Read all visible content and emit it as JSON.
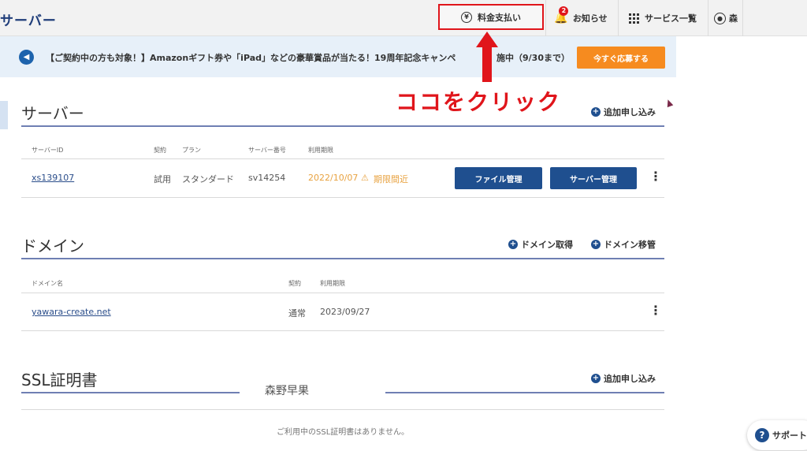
{
  "header": {
    "brand": "サーバー",
    "pay_label": "料金支払い",
    "notice_label": "お知らせ",
    "notice_badge": "2",
    "services_label": "サービス一覧",
    "user_label": "森"
  },
  "banner": {
    "text": "【ご契約中の方も対象！】Amazonギフト券や「iPad」などの豪華賞品が当たる！19周年記念キャンペ",
    "text_tail": "施中（9/30まで）",
    "button_label": "今すぐ応募する"
  },
  "annotation": {
    "text": "ココをクリック",
    "color": "#e0151b"
  },
  "server_section": {
    "title": "サーバー",
    "add_label": "追加申し込み",
    "headers": {
      "id": "サーバーID",
      "contract": "契約",
      "plan": "プラン",
      "server_no": "サーバー番号",
      "period": "利用期限"
    },
    "row": {
      "id": "xs139107",
      "contract": "試用",
      "plan": "スタンダード",
      "server_no": "sv14254",
      "period": "2022/10/07",
      "period_note": "期限間近",
      "file_btn": "ファイル管理",
      "server_btn": "サーバー管理"
    }
  },
  "domain_section": {
    "title": "ドメイン",
    "acquire_label": "ドメイン取得",
    "transfer_label": "ドメイン移管",
    "headers": {
      "name": "ドメイン名",
      "contract": "契約",
      "period": "利用期限"
    },
    "row": {
      "name": "yawara-create.net",
      "contract": "通常",
      "period": "2023/09/27"
    }
  },
  "ssl_section": {
    "title": "SSL証明書",
    "add_label": "追加申し込み",
    "empty": "ご利用中のSSL証明書はありません。"
  },
  "watermark": "森野早果",
  "support": {
    "label": "サポート"
  }
}
